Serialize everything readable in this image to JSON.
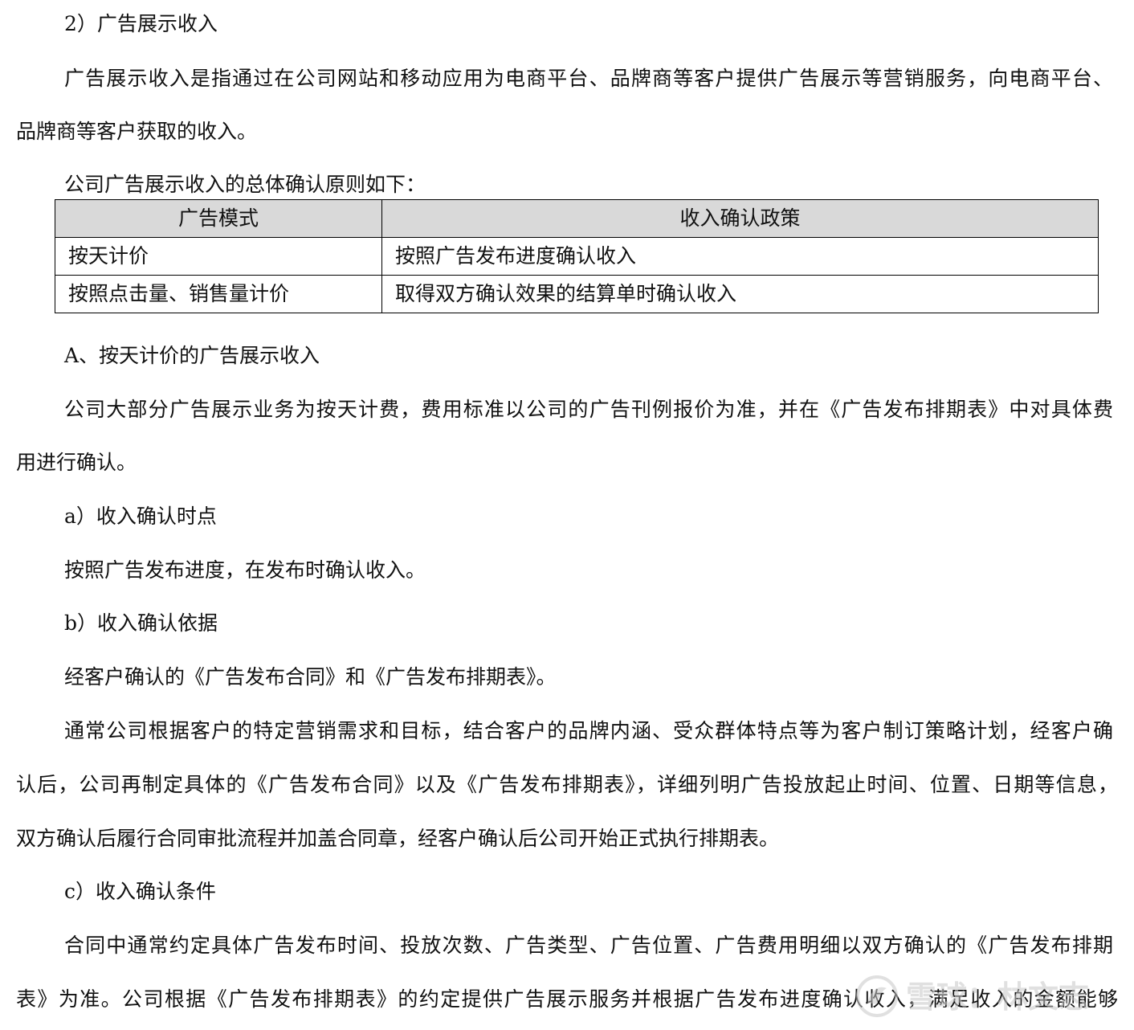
{
  "heading_2": "2）广告展示收入",
  "intro": {
    "line1": "广告展示收入是指通过在公司网站和移动应用为电商平台、品牌商等客户提供广告展示等营销服务，向电商平台、",
    "line2": "品牌商等客户获取的收入。"
  },
  "principle_intro": "公司广告展示收入的总体确认原则如下：",
  "table": {
    "headers": [
      "广告模式",
      "收入确认政策"
    ],
    "rows": [
      [
        "按天计价",
        "按照广告发布进度确认收入"
      ],
      [
        "按照点击量、销售量计价",
        "取得双方确认效果的结算单时确认收入"
      ]
    ]
  },
  "section_a": {
    "title": "A、按天计价的广告展示收入",
    "para_line1": "公司大部分广告展示业务为按天计费，费用标准以公司的广告刊例报价为准，并在《广告发布排期表》中对具体费",
    "para_line2": "用进行确认。"
  },
  "sub_a": {
    "title": "a）收入确认时点",
    "text": "按照广告发布进度，在发布时确认收入。"
  },
  "sub_b": {
    "title": "b）收入确认依据",
    "text": "经客户确认的《广告发布合同》和《广告发布排期表》。",
    "para_line1": "通常公司根据客户的特定营销需求和目标，结合客户的品牌内涵、受众群体特点等为客户制订策略计划，经客户确",
    "para_line2": "认后，公司再制定具体的《广告发布合同》以及《广告发布排期表》，详细列明广告投放起止时间、位置、日期等信息，",
    "para_line3": "双方确认后履行合同审批流程并加盖合同章，经客户确认后公司开始正式执行排期表。"
  },
  "sub_c": {
    "title": "c）收入确认条件",
    "para_line1": "合同中通常约定具体广告发布时间、投放次数、广告类型、广告位置、广告费用明细以双方确认的《广告发布排期",
    "para_line2": "表》为准。公司根据《广告发布排期表》的约定提供广告展示服务并根据广告发布进度确认收入，满足收入的金额能够"
  },
  "watermark": {
    "text": "雪球：林文志",
    "icon": "snowball-logo-icon",
    "color": "#c8c8c8"
  }
}
